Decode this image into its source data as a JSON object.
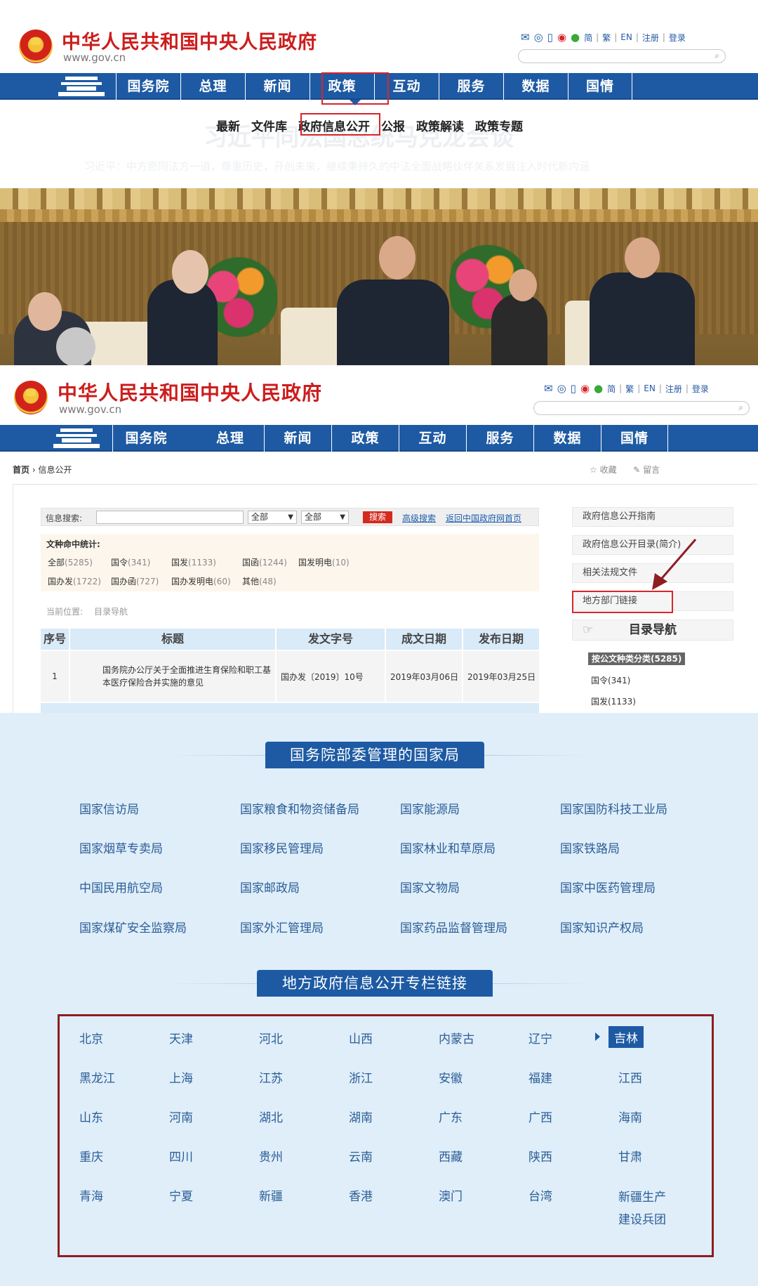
{
  "header": {
    "site_title": "中华人民共和国中央人民政府",
    "site_url": "www.gov.cn",
    "tools": {
      "simplified": "简",
      "traditional": "繁",
      "english": "EN",
      "register": "注册",
      "login": "登录"
    },
    "search_icon": "⌕"
  },
  "nav": {
    "items": [
      "国务院",
      "总理",
      "新闻",
      "政策",
      "互动",
      "服务",
      "数据",
      "国情"
    ],
    "active": "政策"
  },
  "submenu": {
    "items": [
      "最新",
      "文件库",
      "政府信息公开",
      "公报",
      "政策解读",
      "政策专题"
    ],
    "highlighted": "政府信息公开"
  },
  "banner": {
    "ghost_title": "习近平同法国总统马克龙会谈",
    "ghost_subtitle": "习近平：中方愿同法方一道，尊重历史，开创未来，继续秉持久的中法全面战略伙伴关系发展注入时代新内涵"
  },
  "breadcrumb": {
    "home": "首页",
    "separator": "›",
    "current": "信息公开"
  },
  "page_actions": {
    "favorite": "收藏",
    "message": "留言"
  },
  "info_search": {
    "label": "信息搜索:",
    "select1": "全部",
    "select2": "全部",
    "button": "搜索",
    "advanced": "高级搜索",
    "back_home": "返回中国政府网首页"
  },
  "stats": {
    "title": "文种命中统计:",
    "row1": [
      {
        "name": "全部",
        "count": "(5285)"
      },
      {
        "name": "国令",
        "count": "(341)"
      },
      {
        "name": "国发",
        "count": "(1133)"
      },
      {
        "name": "国函",
        "count": "(1244)"
      },
      {
        "name": "国发明电",
        "count": "(10)"
      }
    ],
    "row2": [
      {
        "name": "国办发",
        "count": "(1722)"
      },
      {
        "name": "国办函",
        "count": "(727)"
      },
      {
        "name": "国办发明电",
        "count": "(60)"
      },
      {
        "name": "其他",
        "count": "(48)"
      }
    ]
  },
  "current_position": {
    "label": "当前位置:",
    "value": "目录导航"
  },
  "table": {
    "headers": [
      "序号",
      "标题",
      "发文字号",
      "成文日期",
      "发布日期"
    ],
    "rows": [
      {
        "index": "1",
        "title": "国务院办公厅关于全面推进生育保险和职工基本医疗保险合并实施的意见",
        "doc_no": "国办发〔2019〕10号",
        "written": "2019年03月06日",
        "published": "2019年03月25日"
      }
    ]
  },
  "side_links": [
    "政府信息公开指南",
    "政府信息公开目录(简介)",
    "相关法规文件",
    "地方部门链接"
  ],
  "side_highlighted": "地方部门链接",
  "dir_nav": "目录导航",
  "categories": {
    "badge": "按公文种类分类(5285)",
    "items": [
      "国令(341)",
      "国发(1133)"
    ]
  },
  "bureaus_section": {
    "title": "国务院部委管理的国家局",
    "items": [
      "国家信访局",
      "国家粮食和物资储备局",
      "国家能源局",
      "国家国防科技工业局",
      "国家烟草专卖局",
      "国家移民管理局",
      "国家林业和草原局",
      "国家铁路局",
      "中国民用航空局",
      "国家邮政局",
      "国家文物局",
      "国家中医药管理局",
      "国家煤矿安全监察局",
      "国家外汇管理局",
      "国家药品监督管理局",
      "国家知识产权局"
    ]
  },
  "local_section": {
    "title": "地方政府信息公开专栏链接",
    "selected": "吉林",
    "items": [
      "北京",
      "天津",
      "河北",
      "山西",
      "内蒙古",
      "辽宁",
      "吉林",
      "黑龙江",
      "上海",
      "江苏",
      "浙江",
      "安徽",
      "福建",
      "江西",
      "山东",
      "河南",
      "湖北",
      "湖南",
      "广东",
      "广西",
      "海南",
      "重庆",
      "四川",
      "贵州",
      "云南",
      "西藏",
      "陕西",
      "甘肃",
      "青海",
      "宁夏",
      "新疆",
      "香港",
      "澳门",
      "台湾",
      "新疆生产建设兵团"
    ],
    "last_item_lines": [
      "新疆生产",
      "建设兵团"
    ]
  },
  "colors": {
    "nav_blue": "#1d5aa3",
    "title_red": "#cc1d1d",
    "highlight_red": "#d8252b",
    "frame_red": "#8e1d22",
    "lower_bg": "#dfeef9"
  }
}
